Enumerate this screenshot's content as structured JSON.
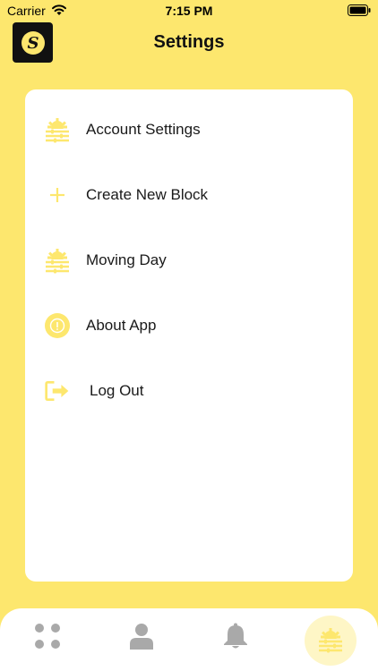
{
  "status_bar": {
    "carrier": "Carrier",
    "time": "7:15 PM"
  },
  "header": {
    "title": "Settings",
    "logo_letter": "S"
  },
  "menu": {
    "items": [
      {
        "label": "Account Settings",
        "icon": "gear-sliders-icon"
      },
      {
        "label": "Create New Block",
        "icon": "plus-icon"
      },
      {
        "label": "Moving Day",
        "icon": "gear-sliders-icon"
      },
      {
        "label": "About App",
        "icon": "info-circle-icon"
      },
      {
        "label": "Log Out",
        "icon": "logout-icon"
      }
    ]
  },
  "tab_bar": {
    "tabs": [
      {
        "name": "home",
        "icon": "grid-dots-icon"
      },
      {
        "name": "profile",
        "icon": "person-icon"
      },
      {
        "name": "notifications",
        "icon": "bell-icon"
      },
      {
        "name": "settings",
        "icon": "gear-sliders-icon",
        "active": true
      }
    ]
  },
  "colors": {
    "accent": "#FDE76E",
    "icon_gray": "#A9A9A9",
    "card": "#FFFFFF"
  }
}
